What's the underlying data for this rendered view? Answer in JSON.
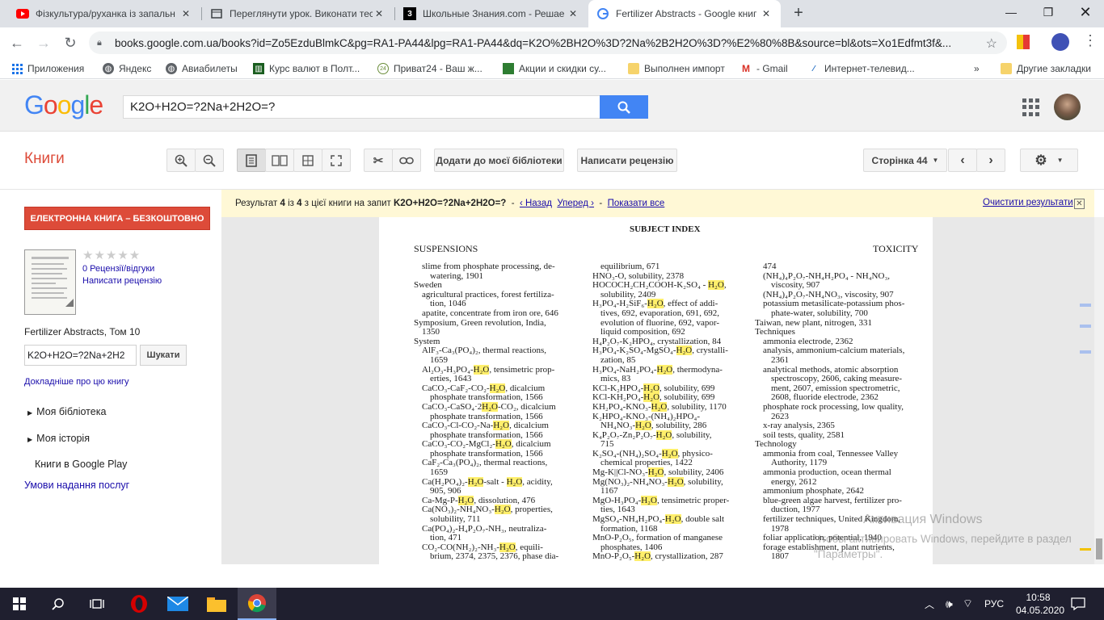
{
  "browser": {
    "tabs": [
      {
        "title": "Фізкультура/руханка із запальн",
        "icon": "youtube-icon"
      },
      {
        "title": "Переглянути урок. Виконати тес",
        "icon": "lesson-icon"
      },
      {
        "title": "Школьные Знания.com - Решае",
        "icon": "znania-icon"
      },
      {
        "title": "Fertilizer Abstracts - Google книг",
        "icon": "google-books-icon"
      }
    ],
    "url": "books.google.com.ua/books?id=Zo5EzduBlmkC&pg=RA1-PA44&lpg=RA1-PA44&dq=K2O%2BH2O%3D?2Na%2B2H2O%3D?%E2%80%8B&source=bl&ots=Xo1Edfmt3f&...",
    "bookmarks": [
      "Приложения",
      "Яндекс",
      "Авиабилеты",
      "Курс валют в Полт...",
      "Приват24 - Ваш ж...",
      "Акции и скидки су...",
      "Выполнен импорт",
      "- Gmail",
      "Интернет-телевид...",
      "»",
      "Другие закладки"
    ]
  },
  "google": {
    "logo": "Google",
    "query": "K2O+H2O=?2Na+2H2O=?"
  },
  "books": {
    "title": "Книги",
    "add_library": "Додати до моєї бібліотеки",
    "write_review": "Написати рецензію",
    "page_label": "Сторінка 44"
  },
  "notice": {
    "prefix": "Результат",
    "num": "4",
    "mid": "із",
    "total": "4",
    "suffix": "з цієї книги на запит",
    "query": "K2O+H2O=?2Na+2H2O=?",
    "sep1": "-",
    "back": "‹ Назад",
    "forward": "Уперед ›",
    "sep2": "-",
    "show_all": "Показати все",
    "clear": "Очистити результати"
  },
  "sidebar": {
    "ebook_button": "ЕЛЕКТРОННА КНИГА – БЕЗКОШТОВНО",
    "stars": "★★★★★",
    "reviews": "0 Рецензії/відгуки",
    "write_review": "Написати рецензію",
    "book_title": "Fertilizer Abstracts, Том 10",
    "search_value": "K2O+H2O=?2Na+2H2",
    "search_button": "Шукати",
    "more_about": "Докладніше про цю книгу",
    "my_library": "Моя бібліотека",
    "my_history": "Моя історія",
    "google_play": "Книги в Google Play",
    "terms": "Умови надання послуг"
  },
  "page_scan": {
    "header_center": "SUBJECT INDEX",
    "header_left": "SUSPENSIONS",
    "header_right": "TOXICITY",
    "col1": [
      [
        "in",
        "slime from phosphate processing, de-"
      ],
      [
        "in2",
        "watering, 1901"
      ],
      [
        "",
        "Sweden"
      ],
      [
        "in",
        "agricultural practices, forest fertiliza-"
      ],
      [
        "in2",
        "tion, 1046"
      ],
      [
        "in",
        "apatite, concentrate from iron ore, 646"
      ],
      [
        "",
        "Symposium, Green revolution, India,"
      ],
      [
        "in",
        "1350"
      ],
      [
        "",
        "System"
      ],
      [
        "in",
        "AlF₃-Ca₃(PO₄)₂, thermal reactions,"
      ],
      [
        "in2",
        "1659"
      ],
      [
        "in",
        "Al₂O₃-H₃PO₄-H₂O, tensimetric prop-"
      ],
      [
        "in2",
        "erties, 1643"
      ],
      [
        "in",
        "CaCO₃-CaF₂-CO₂-H₂O, dicalcium"
      ],
      [
        "in2",
        "phosphate transformation, 1566"
      ],
      [
        "in",
        "CaCO₃-CaSO₄·2H₂O-CO₂, dicalcium"
      ],
      [
        "in2",
        "phosphate transformation, 1566"
      ],
      [
        "in",
        "CaCO₃-Cl-CO₂-Na-H₂O, dicalcium"
      ],
      [
        "in2",
        "phosphate transformation, 1566"
      ],
      [
        "in",
        "CaCO₃-CO₂-MgCl₂-H₂O, dicalcium"
      ],
      [
        "in2",
        "phosphate transformation, 1566"
      ],
      [
        "in",
        "CaF₂-Ca₃(PO₄)₂, thermal reactions,"
      ],
      [
        "in2",
        "1659"
      ],
      [
        "in",
        "Ca(H₂PO₄)₂-H₂O-salt - H₂O, acidity,"
      ],
      [
        "in2",
        "905, 906"
      ],
      [
        "in",
        "Ca-Mg-P-H₂O, dissolution, 476"
      ],
      [
        "in",
        "Ca(NO₃)₂-NH₄NO₃-H₂O, properties,"
      ],
      [
        "in2",
        "solubility, 711"
      ],
      [
        "in",
        "Ca(PO₄)₂-H₄P₂O₇-NH₃, neutraliza-"
      ],
      [
        "in2",
        "tion, 471"
      ],
      [
        "in",
        "CO₂-CO(NH₂)₂-NH₃-H₂O, equili-"
      ],
      [
        "in2",
        "brium, 2374, 2375, 2376, phase dia-"
      ]
    ],
    "col2": [
      [
        "in2",
        "equilibrium, 671"
      ],
      [
        "in",
        "HNO₃-O, solubility, 2378"
      ],
      [
        "in",
        "HOCOCH₂CH₂COOH-K₂SO₄ - H₂O,"
      ],
      [
        "in2",
        "solubility, 2409"
      ],
      [
        "in",
        "H₃PO₄-H₂SiF₆-H₂O, effect of addi-"
      ],
      [
        "in2",
        "tives, 692, evaporation, 691, 692,"
      ],
      [
        "in2",
        "evolution of fluorine, 692, vapor-"
      ],
      [
        "in2",
        "liquid composition, 692"
      ],
      [
        "in",
        "H₄P₂O₇-K₂HPO₄, crystallization, 84"
      ],
      [
        "in",
        "H₃PO₄-K₂SO₄-MgSO₄-H₂O, crystalli-"
      ],
      [
        "in2",
        "zation, 85"
      ],
      [
        "in",
        "H₃PO₄-NaH₂PO₄-H₂O, thermodyna-"
      ],
      [
        "in2",
        "mics, 83"
      ],
      [
        "in",
        "KCl-K₂HPO₄-H₂O, solubility, 699"
      ],
      [
        "in",
        "KCl-KH₂PO₄-H₂O, solubility, 699"
      ],
      [
        "in",
        "KH₂PO₄-KNO₃-H₂O, solubility, 1170"
      ],
      [
        "in",
        "K₂HPO₄-KNO₃-(NH₄)₂HPO₄-"
      ],
      [
        "in2",
        "NH₄NO₃-H₂O, solubility, 286"
      ],
      [
        "in",
        "K₄P₂O₇-Zn₂P₂O₇-H₂O, solubility,"
      ],
      [
        "in2",
        "715"
      ],
      [
        "in",
        "K₂SO₄-(NH₄)₂SO₄-H₂O, physico-"
      ],
      [
        "in2",
        "chemical properties, 1422"
      ],
      [
        "in",
        "Mg-K||Cl-NO₃-H₂O, solubility, 2406"
      ],
      [
        "in",
        "Mg(NO₃)₂-NH₄NO₃-H₂O, solubility,"
      ],
      [
        "in2",
        "1167"
      ],
      [
        "in",
        "MgO-H₃PO₄-H₂O, tensimetric proper-"
      ],
      [
        "in2",
        "ties, 1643"
      ],
      [
        "in",
        "MgSO₄-NH₄H₂PO₄-H₂O, double salt"
      ],
      [
        "in2",
        "formation, 1168"
      ],
      [
        "in",
        "MnO-P₂O₅, formation of manganese"
      ],
      [
        "in2",
        "phosphates, 1406"
      ],
      [
        "in",
        "MnO-P₂O₅-H₂O, crystallization, 287"
      ]
    ],
    "col3": [
      [
        "in",
        "474"
      ],
      [
        "in",
        "(NH₄)₄P₂O₇-NH₄H₂PO₄ - NH₄NO₃,"
      ],
      [
        "in2",
        "viscosity, 907"
      ],
      [
        "in",
        "(NH₄)₄P₂O₇-NH₄NO₃, viscosity, 907"
      ],
      [
        "in",
        "potassium metasilicate-potassium phos-"
      ],
      [
        "in2",
        "phate-water, solubility, 700"
      ],
      [
        "",
        "Taiwan, new plant, nitrogen, 331"
      ],
      [
        "",
        "Techniques"
      ],
      [
        "in",
        "ammonia electrode, 2362"
      ],
      [
        "in",
        "analysis, ammonium-calcium materials,"
      ],
      [
        "in2",
        "2361"
      ],
      [
        "in",
        "analytical methods, atomic absorption"
      ],
      [
        "in2",
        "spectroscopy, 2606, caking measure-"
      ],
      [
        "in2",
        "ment, 2607, emission spectrometric,"
      ],
      [
        "in2",
        "2608, fluoride electrode, 2362"
      ],
      [
        "in",
        "phosphate rock processing, low quality,"
      ],
      [
        "in2",
        "2623"
      ],
      [
        "in",
        "x-ray analysis, 2365"
      ],
      [
        "in",
        "soil tests, quality, 2581"
      ],
      [
        "",
        "Technology"
      ],
      [
        "in",
        "ammonia from coal, Tennessee Valley"
      ],
      [
        "in2",
        "Authority, 1179"
      ],
      [
        "in",
        "ammonia production, ocean thermal"
      ],
      [
        "in2",
        "energy, 2612"
      ],
      [
        "in",
        "ammonium phosphate, 2642"
      ],
      [
        "in",
        "blue-green algae harvest, fertilizer pro-"
      ],
      [
        "in2",
        "duction, 1977"
      ],
      [
        "in",
        "fertilizer techniques, United Kingdom,"
      ],
      [
        "in2",
        "1978"
      ],
      [
        "in",
        "foliar application, potential, 1940"
      ],
      [
        "in",
        "forage establishment, plant nutrients,"
      ],
      [
        "in2",
        "1807"
      ]
    ]
  },
  "watermark": {
    "line1": "Активация Windows",
    "line2": "Чтобы активировать Windows, перейдите в раздел \"Параметры\"."
  },
  "taskbar": {
    "lang": "РУС",
    "time": "10:58",
    "date": "04.05.2020"
  }
}
